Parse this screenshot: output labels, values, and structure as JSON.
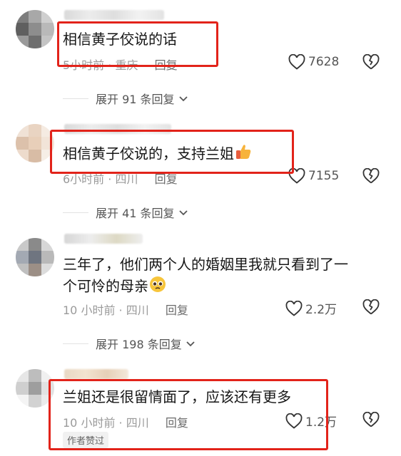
{
  "comments": [
    {
      "text": "相信黄子佼说的话",
      "time": "5小时前",
      "location": "重庆",
      "reply_label": "回复",
      "likes": "7628",
      "expand_label": "展开 91 条回复"
    },
    {
      "text": "相信黄子佼说的，支持兰姐",
      "emoji": "thumbs-up-icon",
      "time": "6小时前",
      "location": "四川",
      "reply_label": "回复",
      "likes": "7155",
      "expand_label": "展开 41 条回复"
    },
    {
      "text_line1": "三年了，他们两个人的婚姻里我就只看到了一",
      "text_line2": "个可怜的母亲",
      "emoji": "pleading-face-icon",
      "time": "10 小时前",
      "location": "四川",
      "reply_label": "回复",
      "likes": "2.2万",
      "expand_label": "展开 198 条回复"
    },
    {
      "text": "兰姐还是很留情面了，应该还有更多",
      "time": "10 小时前",
      "location": "四川",
      "reply_label": "回复",
      "likes": "1.2万",
      "badge": "作者赞过"
    }
  ],
  "colors": {
    "highlight": "#e2231a",
    "meta_text": "#9a9a9a"
  }
}
